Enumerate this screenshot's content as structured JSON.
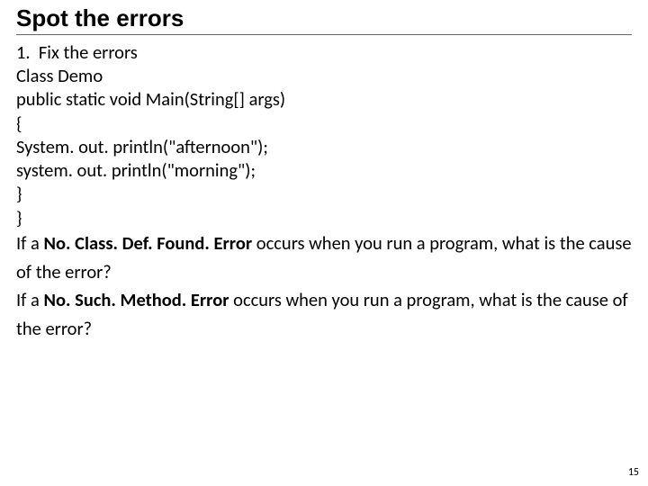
{
  "title": "Spot the errors",
  "list_number": "1.",
  "list_label": "Fix the errors",
  "code": {
    "l1": "Class Demo",
    "l2": "public static void Main(String[] args)",
    "l3": "{",
    "l4": "System. out. println(\"afternoon\");",
    "l5": "system. out. println(\"morning\");",
    "l6": "}",
    "l7": "}"
  },
  "q1_a": "If a ",
  "q1_b": "No. Class. Def. Found. Error",
  "q1_c": " occurs when you run a program, what is the cause of the error?",
  "q2_a": "If a ",
  "q2_b": "No. Such. Method. Error",
  "q2_c": " occurs when you run a program, what is the cause of the error?",
  "page_number": "15"
}
